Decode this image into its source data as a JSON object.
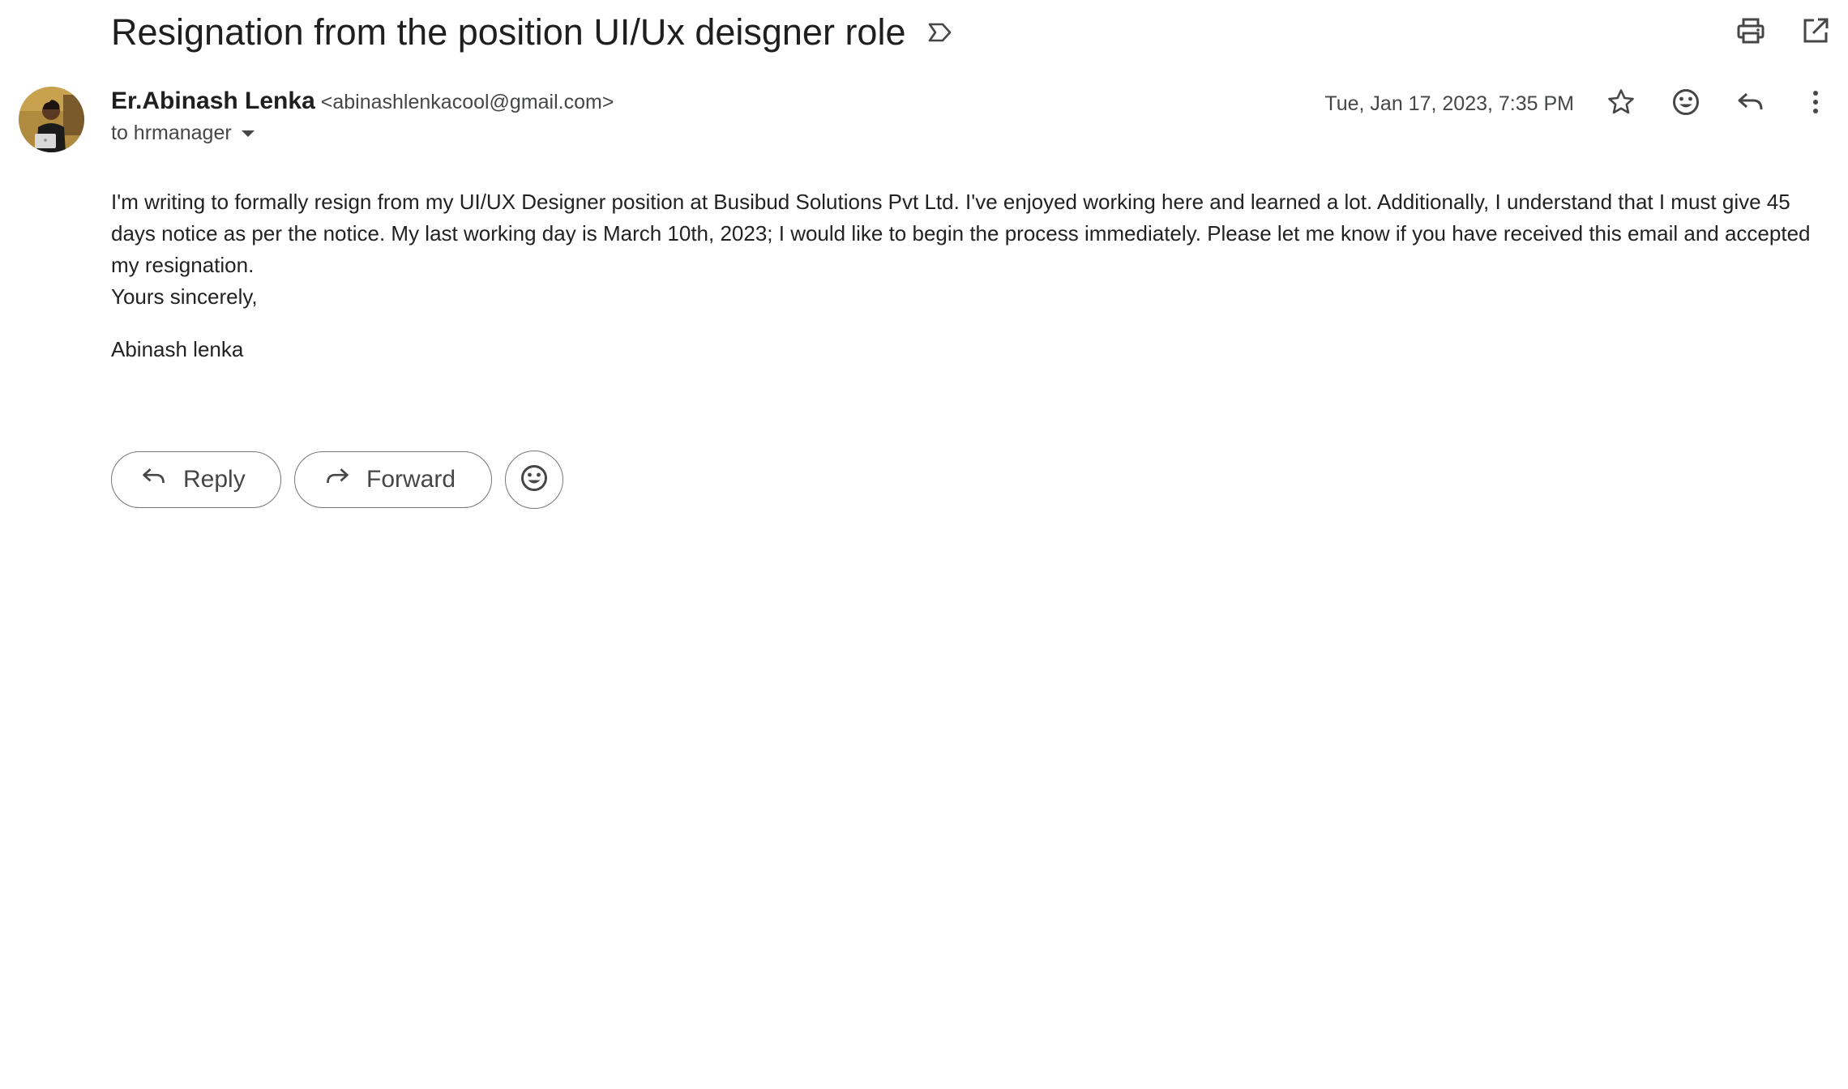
{
  "email": {
    "subject": "Resignation from the position UI/Ux deisgner role",
    "sender": {
      "name": "Er.Abinash Lenka",
      "email": "<abinashlenkacool@gmail.com>"
    },
    "recipient_text": "to hrmanager",
    "date": "Tue, Jan 17, 2023, 7:35 PM",
    "body": {
      "paragraph": "I'm writing to formally resign from my UI/UX Designer position at Busibud Solutions Pvt Ltd. I've enjoyed working here and learned a lot. Additionally, I understand that I must give 45 days notice as per the notice. My last working day is March 10th, 2023; I would like to begin the process immediately. Please let me know if you have received this email and accepted my resignation.",
      "closing": "Yours sincerely,",
      "signature": "Abinash lenka"
    }
  },
  "actions": {
    "reply_label": "Reply",
    "forward_label": "Forward"
  },
  "icons": {
    "label": "label-icon",
    "print": "print-icon",
    "open_new_window": "open-in-new-window-icon",
    "star": "star-icon",
    "emoji": "emoji-reaction-icon",
    "reply": "reply-icon",
    "more": "more-vert-icon",
    "forward": "forward-icon"
  },
  "colors": {
    "text_primary": "#1f1f1f",
    "text_secondary": "#444746",
    "icon": "#444746",
    "border": "#747775"
  }
}
